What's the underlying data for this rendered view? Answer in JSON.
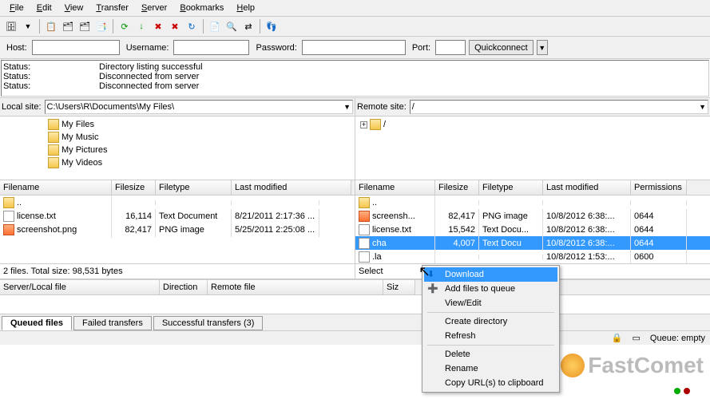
{
  "menu": [
    "File",
    "Edit",
    "View",
    "Transfer",
    "Server",
    "Bookmarks",
    "Help"
  ],
  "connect": {
    "host_lbl": "Host:",
    "host": "",
    "user_lbl": "Username:",
    "user": "",
    "pass_lbl": "Password:",
    "pass": "",
    "port_lbl": "Port:",
    "port": "",
    "quick": "Quickconnect"
  },
  "status": [
    {
      "k": "Status:",
      "v": "Directory listing successful"
    },
    {
      "k": "Status:",
      "v": "Disconnected from server"
    },
    {
      "k": "Status:",
      "v": "Disconnected from server"
    }
  ],
  "local": {
    "lbl": "Local site:",
    "path": "C:\\Users\\R\\Documents\\My Files\\",
    "tree": [
      "My Files",
      "My Music",
      "My Pictures",
      "My Videos"
    ],
    "cols": [
      "Filename",
      "Filesize",
      "Filetype",
      "Last modified"
    ],
    "rows": [
      {
        "icon": "folder",
        "name": "..",
        "size": "",
        "type": "",
        "mod": ""
      },
      {
        "icon": "file",
        "name": "license.txt",
        "size": "16,114",
        "type": "Text Document",
        "mod": "8/21/2011 2:17:36 ..."
      },
      {
        "icon": "png",
        "name": "screenshot.png",
        "size": "82,417",
        "type": "PNG image",
        "mod": "5/25/2011 2:25:08 ..."
      }
    ],
    "statusline": "2 files. Total size: 98,531 bytes"
  },
  "remote": {
    "lbl": "Remote site:",
    "path": "/",
    "tree_root": "/",
    "cols": [
      "Filename",
      "Filesize",
      "Filetype",
      "Last modified",
      "Permissions"
    ],
    "sort_col": "Last modified",
    "rows": [
      {
        "icon": "folder",
        "name": "..",
        "size": "",
        "type": "",
        "mod": "",
        "perm": ""
      },
      {
        "icon": "png",
        "name": "screensh...",
        "size": "82,417",
        "type": "PNG image",
        "mod": "10/8/2012 6:38:...",
        "perm": "0644"
      },
      {
        "icon": "file",
        "name": "license.txt",
        "size": "15,542",
        "type": "Text Docu...",
        "mod": "10/8/2012 6:38:...",
        "perm": "0644"
      },
      {
        "icon": "file",
        "name": "cha",
        "size": "4,007",
        "type": "Text Docu",
        "mod": "10/8/2012 6:38:...",
        "perm": "0644",
        "selected": true
      },
      {
        "icon": "file",
        "name": ".la",
        "size": "",
        "type": "",
        "mod": "10/8/2012 1:53:...",
        "perm": "0600"
      }
    ],
    "statusline": "Select"
  },
  "queue": {
    "cols": [
      "Server/Local file",
      "Direction",
      "Remote file",
      "Siz"
    ],
    "tabs": [
      "Queued files",
      "Failed transfers",
      "Successful transfers (3)"
    ],
    "active_tab": 0
  },
  "context": {
    "items": [
      {
        "t": "Download",
        "icon": "download",
        "hl": true
      },
      {
        "t": "Add files to queue",
        "icon": "add"
      },
      {
        "t": "View/Edit"
      },
      {
        "sep": true
      },
      {
        "t": "Create directory"
      },
      {
        "t": "Refresh"
      },
      {
        "sep": true
      },
      {
        "t": "Delete"
      },
      {
        "t": "Rename"
      },
      {
        "t": "Copy URL(s) to clipboard"
      }
    ]
  },
  "bottom": {
    "queue_lbl": "Queue: empty"
  },
  "watermark": "FastComet"
}
